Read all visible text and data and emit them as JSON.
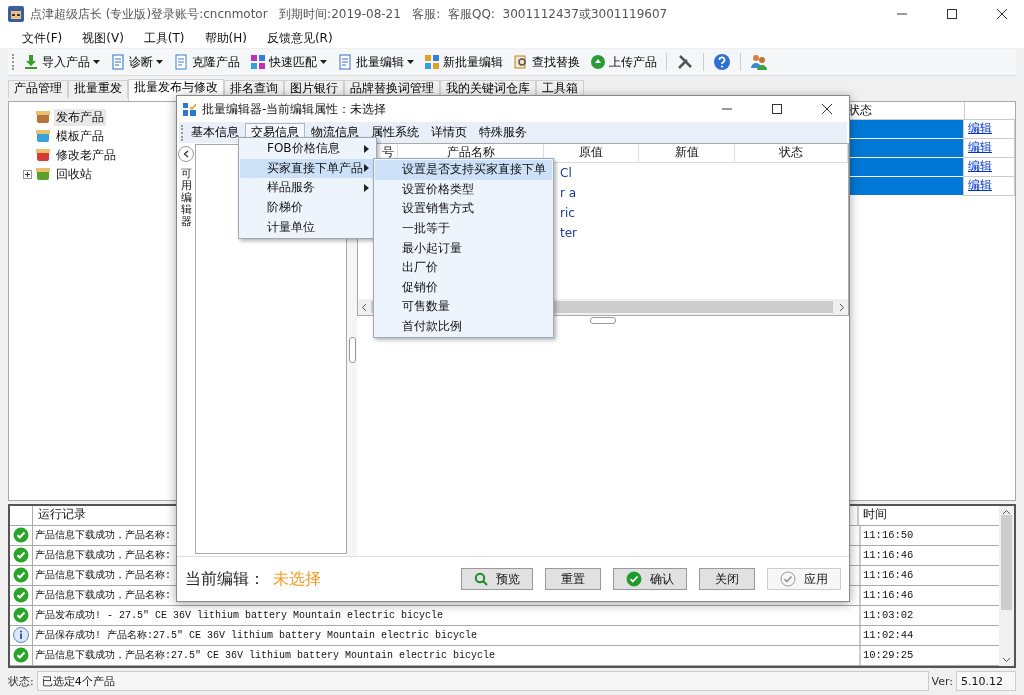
{
  "window": {
    "title": "点津超级店长 (专业版)登录账号:cncnmotor   到期时间:2019-08-21   客服:  客服QQ:  3001112437或3001119607"
  },
  "menu": [
    "文件(F)",
    "视图(V)",
    "工具(T)",
    "帮助(H)",
    "反馈意见(R)"
  ],
  "toolbar": [
    {
      "label": "导入产品",
      "dropdown": true
    },
    {
      "label": "诊断",
      "dropdown": true
    },
    {
      "label": "克隆产品",
      "dropdown": false
    },
    {
      "label": "快速匹配",
      "dropdown": true
    },
    {
      "label": "批量编辑",
      "dropdown": true
    },
    {
      "label": "新批量编辑",
      "dropdown": false
    },
    {
      "label": "查找替换",
      "dropdown": false
    },
    {
      "label": "上传产品",
      "dropdown": false
    }
  ],
  "main_tabs": [
    {
      "label": "产品管理",
      "selected": false
    },
    {
      "label": "批量重发",
      "selected": false
    },
    {
      "label": "批量发布与修改",
      "selected": true
    },
    {
      "label": "排名查询",
      "selected": false
    },
    {
      "label": "图片银行",
      "selected": false
    },
    {
      "label": "品牌替换词管理",
      "selected": false
    },
    {
      "label": "我的关键词仓库",
      "selected": false
    },
    {
      "label": "工具箱",
      "selected": false
    }
  ],
  "tree": [
    {
      "label": "发布产品",
      "selected": true
    },
    {
      "label": "模板产品",
      "selected": false
    },
    {
      "label": "修改老产品",
      "selected": false
    },
    {
      "label": "回收站",
      "selected": false,
      "expanded": false
    }
  ],
  "main_table": {
    "status_header": "状态",
    "rows": [
      {
        "selected": true,
        "link": "编辑"
      },
      {
        "selected": true,
        "link": "编辑"
      },
      {
        "selected": true,
        "link": "编辑"
      },
      {
        "selected": true,
        "link": "编辑"
      }
    ]
  },
  "dialog": {
    "title": "批量编辑器-当前编辑属性：未选择",
    "tabs": [
      {
        "label": "基本信息",
        "selected": false
      },
      {
        "label": "交易信息",
        "selected": true
      },
      {
        "label": "物流信息",
        "selected": false
      },
      {
        "label": "属性系统",
        "selected": false
      },
      {
        "label": "详情页",
        "selected": false
      },
      {
        "label": "特殊服务",
        "selected": false
      }
    ],
    "side_label": "可用编辑器",
    "columns": [
      "号",
      "产品名称",
      "原值",
      "新值",
      "状态"
    ],
    "rows": [
      "Cl",
      "r a",
      "ric",
      "ter"
    ],
    "current_edit_label": "当前编辑：",
    "current_edit_value": "未选择",
    "buttons": [
      {
        "label": "预览",
        "disabled": false
      },
      {
        "label": "重置",
        "disabled": false
      },
      {
        "label": "确认",
        "disabled": false
      },
      {
        "label": "关闭",
        "disabled": false
      },
      {
        "label": "应用",
        "disabled": true
      }
    ]
  },
  "menu_popup": [
    {
      "label": "FOB价格信息",
      "submenu": true,
      "selected": false
    },
    {
      "label": "买家直接下单产品",
      "submenu": true,
      "selected": true
    },
    {
      "label": "样品服务",
      "submenu": true,
      "selected": false
    },
    {
      "label": "阶梯价",
      "submenu": false,
      "selected": false
    },
    {
      "label": "计量单位",
      "submenu": false,
      "selected": false
    }
  ],
  "submenu_popup": [
    {
      "label": "设置是否支持买家直接下单",
      "selected": true
    },
    {
      "label": "设置价格类型",
      "selected": false
    },
    {
      "label": "设置销售方式",
      "selected": false
    },
    {
      "label": "一批等于",
      "selected": false
    },
    {
      "label": "最小起订量",
      "selected": false
    },
    {
      "label": "出厂价",
      "selected": false
    },
    {
      "label": "促销价",
      "selected": false
    },
    {
      "label": "可售数量",
      "selected": false
    },
    {
      "label": "首付款比例",
      "selected": false
    }
  ],
  "log": {
    "columns": [
      "运行记录",
      "时间"
    ],
    "rows": [
      {
        "kind": "ok",
        "message": "产品信息下载成功，产品名称:",
        "time": "11:16:50"
      },
      {
        "kind": "ok",
        "message": "产品信息下载成功，产品名称:",
        "time": "11:16:46"
      },
      {
        "kind": "ok",
        "message": "产品信息下载成功，产品名称:",
        "time": "11:16:46"
      },
      {
        "kind": "ok",
        "message": "产品信息下载成功，产品名称:",
        "time": "11:16:46"
      },
      {
        "kind": "ok",
        "message": "产品发布成功! - 27.5″ CE 36V lithium battery Mountain electric bicycle",
        "time": "11:03:02"
      },
      {
        "kind": "info",
        "message": "产品保存成功! 产品名称:27.5″ CE 36V lithium battery Mountain electric bicycle",
        "time": "11:02:44"
      },
      {
        "kind": "ok",
        "message": "产品信息下载成功，产品名称:27.5″ CE 36V lithium battery Mountain electric bicycle",
        "time": "10:29:25"
      }
    ]
  },
  "status": {
    "label": "状态:",
    "value": "已选定4个产品",
    "ver_label": "Ver:",
    "ver_value": "5.10.12"
  }
}
